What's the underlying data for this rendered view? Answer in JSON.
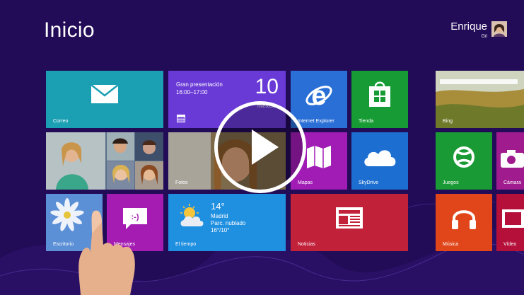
{
  "screen": {
    "title": "Inicio"
  },
  "user": {
    "first_name": "Enrique",
    "last_name": "Gil"
  },
  "tiles": {
    "correo": {
      "label": "Correo",
      "color": "#1a9fb3",
      "icon": "mail-icon"
    },
    "calendar": {
      "event_title": "Gran presentación",
      "event_time": "16:00–17:00",
      "day": "10",
      "weekday": "miércoles",
      "color": "#6a3ad6"
    },
    "ie": {
      "label": "Internet Explorer",
      "color": "#2a6fd6",
      "icon": "internet-explorer-icon"
    },
    "tienda": {
      "label": "Tienda",
      "color": "#179c35",
      "icon": "store-icon"
    },
    "bing": {
      "label": "Bing",
      "color": "#9c8a3a"
    },
    "people": {
      "label": "",
      "color": "#5a6e8a"
    },
    "fotos": {
      "label": "Fotos",
      "color": "#6b4a2a"
    },
    "mapas": {
      "label": "Mapas",
      "color": "#a01cb5",
      "icon": "map-icon"
    },
    "skydrive": {
      "label": "SkyDrive",
      "color": "#1c6fd0",
      "icon": "cloud-icon"
    },
    "juegos": {
      "label": "Juegos",
      "color": "#1a9a35",
      "icon": "gamepad-icon"
    },
    "camara": {
      "label": "Cámara",
      "color": "#a01c8e",
      "icon": "camera-icon"
    },
    "escritorio": {
      "label": "Escritorio",
      "color": "#3d6fc4"
    },
    "mensajes": {
      "label": "Mensajes",
      "color": "#a51cb3",
      "icon": "messaging-icon"
    },
    "tiempo": {
      "label": "El tiempo",
      "temp": "14°",
      "city": "Madrid",
      "condition": "Parc. nublado",
      "range": "16°/10°",
      "color": "#1f8fe0",
      "icon": "sun-cloud-icon"
    },
    "noticias": {
      "label": "Noticias",
      "color": "#c2213a",
      "icon": "news-icon"
    },
    "musica": {
      "label": "Música",
      "color": "#e04619",
      "icon": "headphones-icon"
    },
    "video": {
      "label": "Vídeo",
      "color": "#b4103a",
      "icon": "video-icon"
    }
  },
  "player": {
    "icon": "play-icon"
  }
}
